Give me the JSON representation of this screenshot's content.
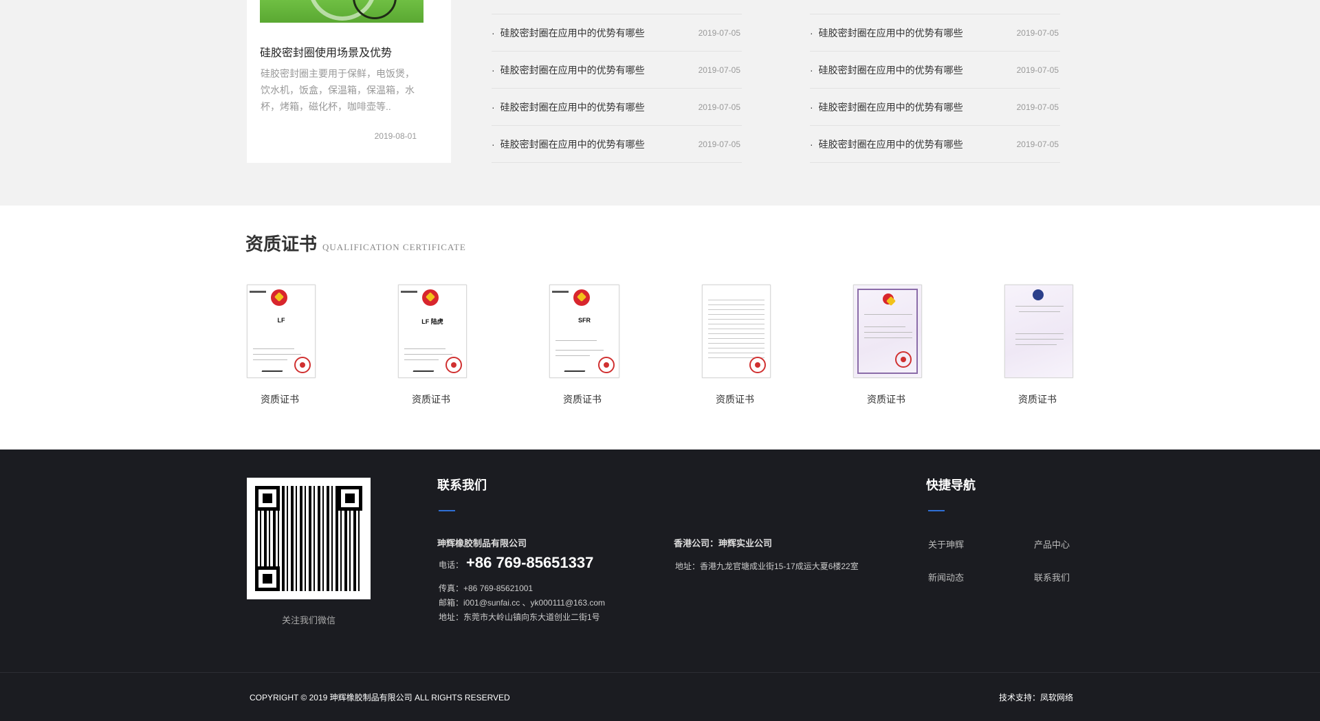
{
  "feature": {
    "title": "硅胶密封圈使用场景及优势",
    "desc": "硅胶密封圈主要用于保鲜，电饭煲，饮水机，饭盒，保温箱，保温箱，水杯，烤箱，磁化杯，咖啡壶等..",
    "date": "2019-08-01"
  },
  "news": {
    "col1": [
      {
        "title": "硅胶密封圈在应用中的优势有哪些",
        "date": "2019-07-05"
      },
      {
        "title": "硅胶密封圈在应用中的优势有哪些",
        "date": "2019-07-05"
      },
      {
        "title": "硅胶密封圈在应用中的优势有哪些",
        "date": "2019-07-05"
      },
      {
        "title": "硅胶密封圈在应用中的优势有哪些",
        "date": "2019-07-05"
      }
    ],
    "col2": [
      {
        "title": "硅胶密封圈在应用中的优势有哪些",
        "date": "2019-07-05"
      },
      {
        "title": "硅胶密封圈在应用中的优势有哪些",
        "date": "2019-07-05"
      },
      {
        "title": "硅胶密封圈在应用中的优势有哪些",
        "date": "2019-07-05"
      },
      {
        "title": "硅胶密封圈在应用中的优势有哪些",
        "date": "2019-07-05"
      }
    ],
    "bullet": "·"
  },
  "certs": {
    "heading_cn": "资质证书",
    "heading_en": "QUALIFICATION CERTIFICATE",
    "items": [
      {
        "label": "资质证书",
        "mark": "LF"
      },
      {
        "label": "资质证书",
        "mark": "LF 陆虎"
      },
      {
        "label": "资质证书",
        "mark": "SFR"
      },
      {
        "label": "资质证书",
        "mark": ""
      },
      {
        "label": "资质证书",
        "mark": ""
      },
      {
        "label": "资质证书",
        "mark": ""
      }
    ]
  },
  "footer": {
    "qr_caption": "关注我们微信",
    "contact_heading": "联系我们",
    "company_name": "珅辉橡胶制品有限公司",
    "phone_label": "电话：",
    "phone_value": "+86 769-85651337",
    "fax": "传真：+86 769-85621001",
    "email": "邮箱：i001@sunfai.cc 、yk000111@163.com",
    "address": "地址：东莞市大岭山镇向东大道创业二街1号",
    "hk_name": "香港公司：珅辉实业公司",
    "hk_address": "地址：香港九龙官塘成业街15-17成运大夏6楼22室",
    "quick_heading": "快捷导航",
    "quick_links": [
      "关于珅辉",
      "产品中心",
      "新闻动态",
      "联系我们"
    ],
    "copyright": "COPYRIGHT © 2019 珅辉橡胶制品有限公司  ALL RIGHTS RESERVED",
    "tech": "技术支持：凤软网络"
  },
  "colors": {
    "footer_bg": "#1b1c21",
    "accent": "#2f6fd6",
    "section_bg": "#f2f2f2"
  }
}
